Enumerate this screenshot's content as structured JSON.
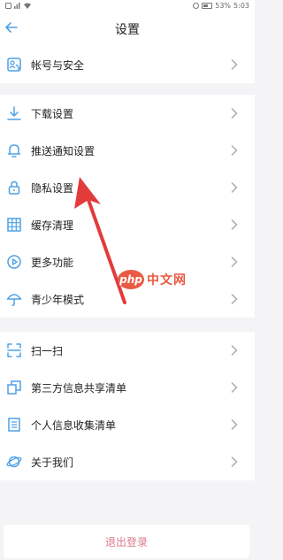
{
  "status_bar": {
    "left_icons": [
      "notification-icon",
      "sim-icon",
      "wifi-icon"
    ],
    "battery": "53%",
    "time": "5:03"
  },
  "header": {
    "back_icon": "back-arrow-icon",
    "title": "设置"
  },
  "menu": {
    "account": {
      "icon": "account-security-icon",
      "label": "帐号与安全"
    },
    "download": {
      "icon": "download-icon",
      "label": "下载设置"
    },
    "push": {
      "icon": "bell-icon",
      "label": "推送通知设置"
    },
    "privacy": {
      "icon": "lock-icon",
      "label": "隐私设置"
    },
    "cache": {
      "icon": "grid-icon",
      "label": "缓存清理"
    },
    "more": {
      "icon": "play-circle-icon",
      "label": "更多功能"
    },
    "youth": {
      "icon": "umbrella-icon",
      "label": "青少年模式"
    },
    "scan": {
      "icon": "scan-icon",
      "label": "扫一扫"
    },
    "third_party": {
      "icon": "copy-icon",
      "label": "第三方信息共享清单"
    },
    "personal_info": {
      "icon": "document-list-icon",
      "label": "个人信息收集清单"
    },
    "about": {
      "icon": "planet-icon",
      "label": "关于我们"
    }
  },
  "logout": {
    "label": "退出登录"
  },
  "watermark": {
    "logo": "php",
    "text": "中文网"
  },
  "colors": {
    "icon": "#4ea1e6",
    "logout_text": "#d87a8a",
    "arrow": "#e23b3b",
    "watermark": "#e95a43",
    "background": "#f4f4f6"
  }
}
